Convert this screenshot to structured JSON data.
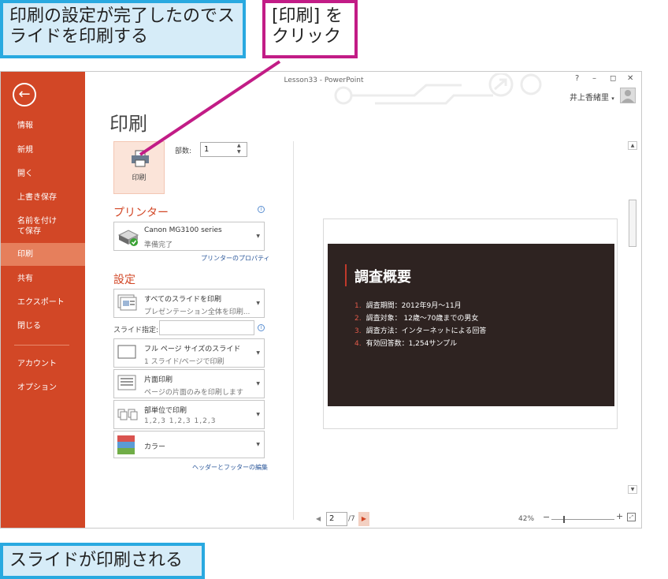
{
  "callouts": {
    "top_left": "印刷の設定が完了したのでスライドを印刷する",
    "top_right": "[印刷] をクリック",
    "bottom": "スライドが印刷される"
  },
  "window": {
    "title": "Lesson33 - PowerPoint",
    "controls": {
      "help": "?",
      "minimize": "–",
      "restore": "◻",
      "close": "✕"
    },
    "user_name": "井上香緒里",
    "user_caret": "▾"
  },
  "sidebar": {
    "back_icon": "←",
    "items": [
      {
        "label": "情報"
      },
      {
        "label": "新規"
      },
      {
        "label": "開く"
      },
      {
        "label": "上書き保存"
      },
      {
        "label": "名前を付けて保存"
      },
      {
        "label": "印刷",
        "active": true
      },
      {
        "label": "共有"
      },
      {
        "label": "エクスポート"
      },
      {
        "label": "閉じる"
      },
      {
        "label": "アカウント"
      },
      {
        "label": "オプション"
      }
    ]
  },
  "print": {
    "page_title": "印刷",
    "button_label": "印刷",
    "copies_label": "部数:",
    "copies_value": "1",
    "printer": {
      "heading": "プリンター",
      "name": "Canon MG3100 series",
      "status": "準備完了",
      "properties_link": "プリンターのプロパティ"
    },
    "settings": {
      "heading": "設定",
      "range": {
        "title": "すべてのスライドを印刷",
        "subtitle": "プレゼンテーション全体を印刷..."
      },
      "slides_label": "スライド指定:",
      "slides_value": "",
      "layout": {
        "title": "フル ページ サイズのスライド",
        "subtitle": "1 スライド/ページで印刷"
      },
      "sides": {
        "title": "片面印刷",
        "subtitle": "ページの片面のみを印刷します"
      },
      "collate": {
        "title": "部単位で印刷",
        "subtitle": "1,2,3  1,2,3  1,2,3"
      },
      "color": {
        "title": "カラー"
      },
      "header_footer_link": "ヘッダーとフッターの編集"
    }
  },
  "preview": {
    "slide_title": "調査概要",
    "items": [
      {
        "num": "1.",
        "text": "調査期間：2012年9月～11月"
      },
      {
        "num": "2.",
        "text": "調査対象： 12歳～70歳までの男女"
      },
      {
        "num": "3.",
        "text": "調査方法：インターネットによる回答"
      },
      {
        "num": "4.",
        "text": "有効回答数：1,254サンプル"
      }
    ],
    "page_current": "2",
    "page_total": "/7",
    "zoom": "42%",
    "zoom_minus": "−",
    "zoom_plus": "+"
  },
  "colors": {
    "sidebar": "#d24726",
    "sidebar_active": "#e67f5c",
    "accent": "#d24726",
    "callout_blue": "#29a9e0",
    "callout_pink": "#c21c86"
  }
}
